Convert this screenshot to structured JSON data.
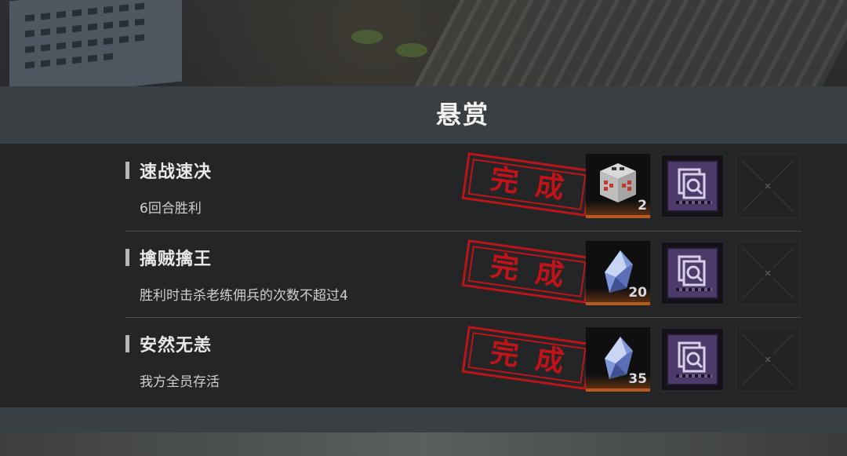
{
  "panel": {
    "title": "悬赏"
  },
  "bounties": [
    {
      "title": "速战速决",
      "description": "6回合胜利",
      "stamp": "完成",
      "reward_icon": "mystery-cube-icon",
      "reward_count": "2",
      "buff_icon": "scan-card-icon",
      "empty_slot_icon": "empty-slot-icon"
    },
    {
      "title": "擒贼擒王",
      "description": "胜利时击杀老练佣兵的次数不超过4",
      "stamp": "完成",
      "reward_icon": "crystal-shard-icon",
      "reward_count": "20",
      "buff_icon": "scan-card-icon",
      "empty_slot_icon": "empty-slot-icon"
    },
    {
      "title": "安然无恙",
      "description": "我方全员存活",
      "stamp": "完成",
      "reward_icon": "crystal-shard-icon",
      "reward_count": "35",
      "buff_icon": "scan-card-icon",
      "empty_slot_icon": "empty-slot-icon"
    }
  ],
  "colors": {
    "stamp": "#d01218",
    "reward_rarity": "#b8581c",
    "buff_card": "#4b3a6a"
  }
}
